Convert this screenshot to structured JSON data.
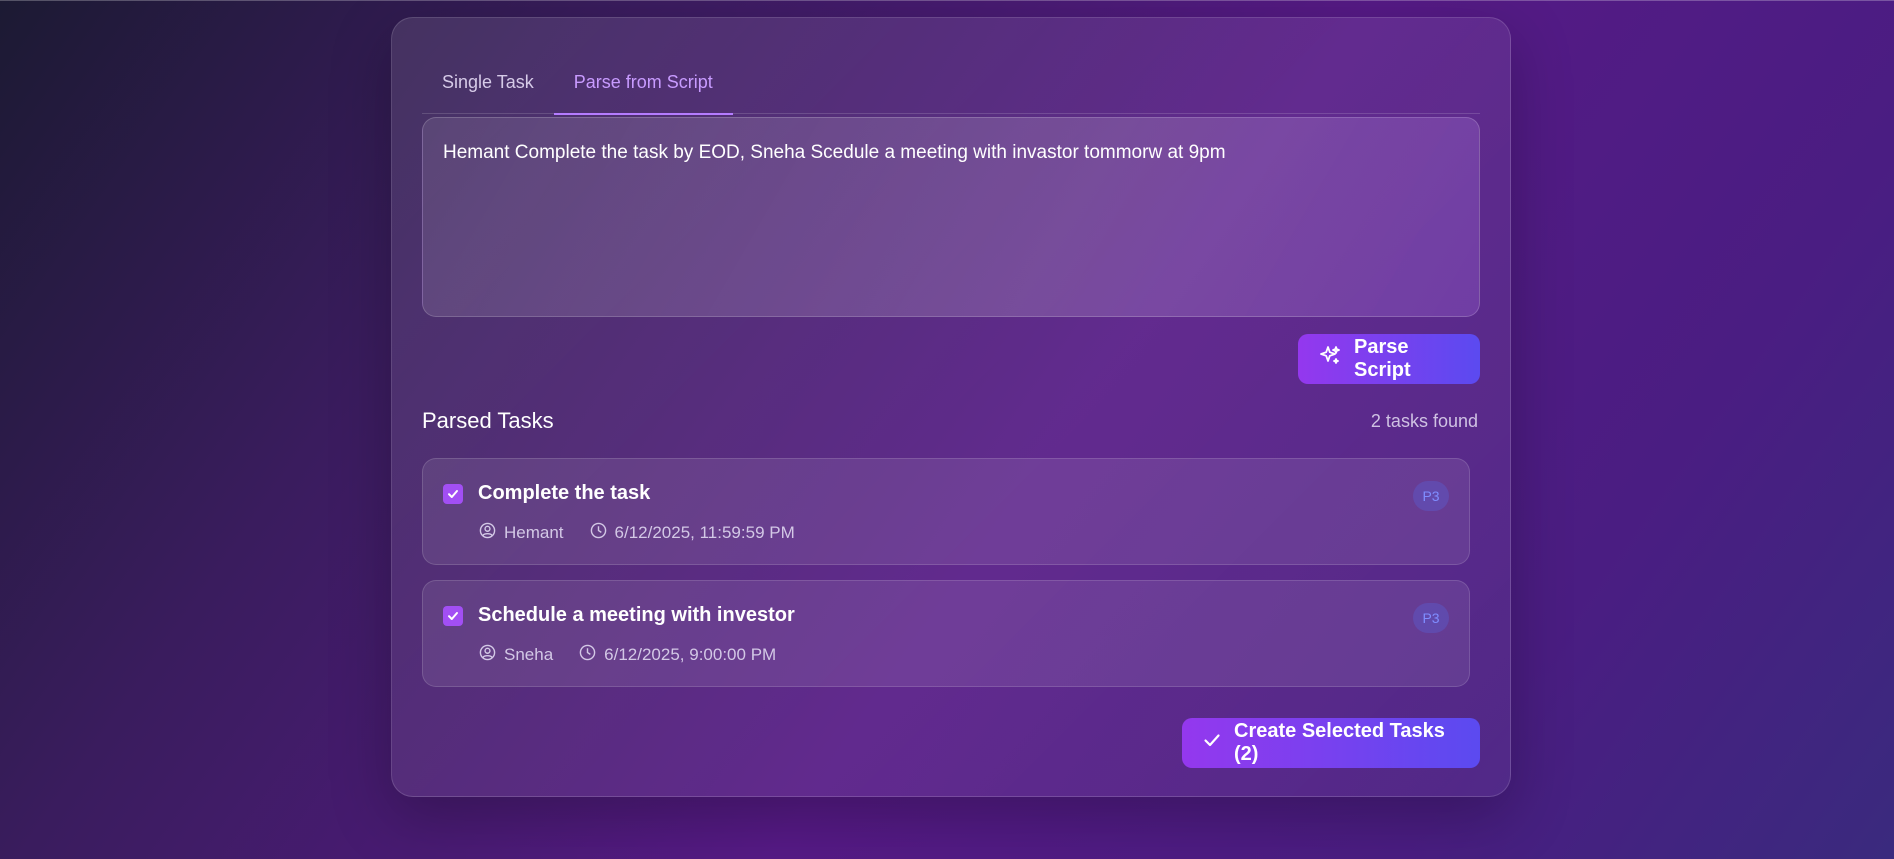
{
  "tabs": [
    {
      "label": "Single Task"
    },
    {
      "label": "Parse from Script"
    }
  ],
  "script": {
    "value": "Hemant Complete the task by EOD, Sneha Scedule a meeting with invastor tommorw at 9pm"
  },
  "parse_button": {
    "label": "Parse Script",
    "icon": "sparkles-icon"
  },
  "parsed": {
    "title": "Parsed Tasks",
    "count_text": "2 tasks found",
    "tasks": [
      {
        "title": "Complete the task",
        "assignee": "Hemant",
        "due": "6/12/2025, 11:59:59 PM",
        "priority": "P3",
        "checked": true
      },
      {
        "title": "Schedule a meeting with investor",
        "assignee": "Sneha",
        "due": "6/12/2025, 9:00:00 PM",
        "priority": "P3",
        "checked": true
      }
    ]
  },
  "create_button": {
    "label": "Create Selected Tasks (2)",
    "icon": "check-icon"
  },
  "colors": {
    "accent": "#9438ee",
    "accent2": "#5b4af0",
    "tab_active": "#c89bff"
  }
}
